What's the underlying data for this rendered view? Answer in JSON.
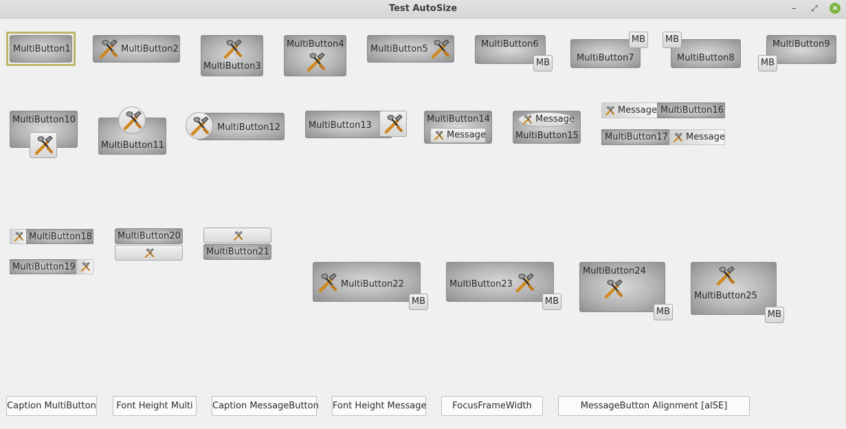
{
  "window": {
    "title": "Test AutoSize",
    "minimize_glyph": "–",
    "restore_glyph": "⤢",
    "close_glyph": "×"
  },
  "buttons": {
    "b1": "MultiButton1",
    "b2": "MultiButton2",
    "b3": "MultiButton3",
    "b4": "MultiButton4",
    "b5": "MultiButton5",
    "b6": "MultiButton6",
    "b7": "MultiButton7",
    "b8": "MultiButton8",
    "b9": "MultiButton9",
    "b10": "MultiButton10",
    "b11": "MultiButton11",
    "b12": "MultiButton12",
    "b13": "MultiButton13",
    "b14": "MultiButton14",
    "b15": "MultiButton15",
    "b16": "MultiButton16",
    "b17": "MultiButton17",
    "b18": "MultiButton18",
    "b19": "MultiButton19",
    "b20": "MultiButton20",
    "b21": "MultiButton21",
    "b22": "MultiButton22",
    "b23": "MultiButton23",
    "b24": "MultiButton24",
    "b25": "MultiButton25"
  },
  "message_buttons": {
    "mb_label": "MB",
    "message_label": "Message"
  },
  "icon_name": "hammer-wrench-icon",
  "bottom_buttons": {
    "caption_multi": "Caption MultiButton",
    "font_multi": "Font Height Multi",
    "caption_message": "Caption MessageButton",
    "font_message": "Font Height Message",
    "focus_frame": "FocusFrameWidth",
    "alignment": "MessageButton Alignment [alSE]"
  },
  "colors": {
    "focus_frame": "#bdb66a",
    "close_button": "#7cb342"
  }
}
